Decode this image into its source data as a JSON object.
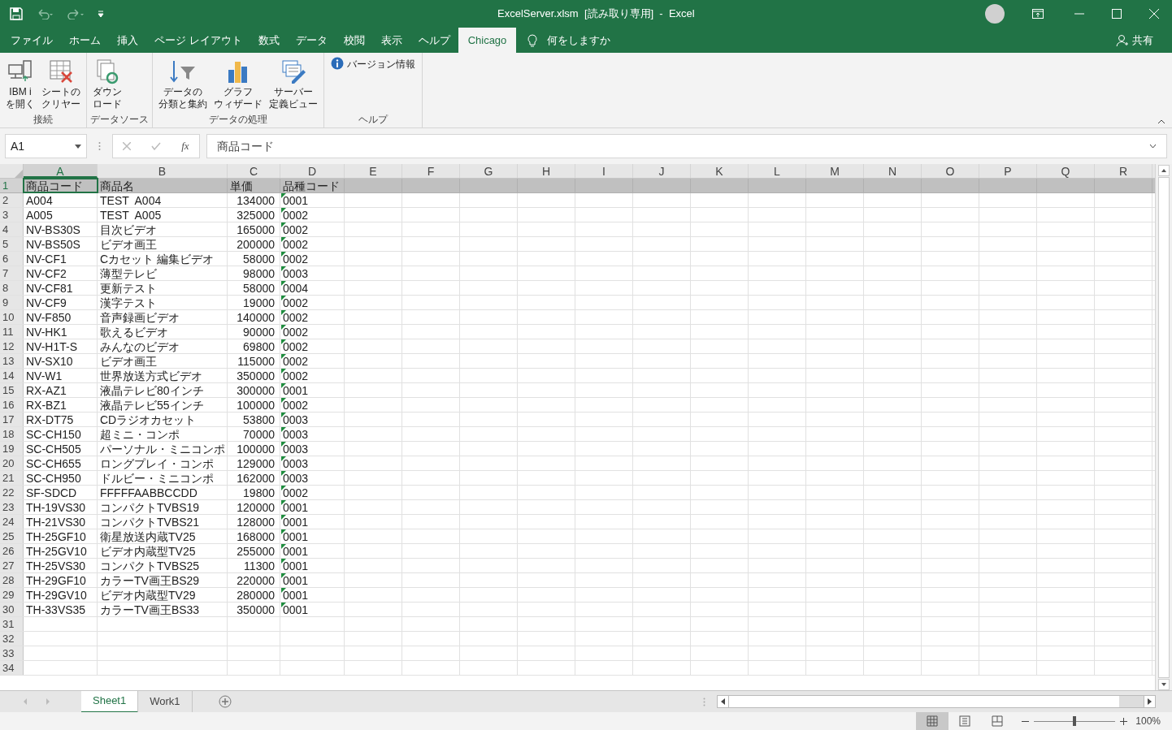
{
  "window": {
    "title": "ExcelServer.xlsm  [読み取り専用]  -  Excel"
  },
  "menu_tabs": [
    {
      "label": "ファイル",
      "selected": false
    },
    {
      "label": "ホーム",
      "selected": false
    },
    {
      "label": "挿入",
      "selected": false
    },
    {
      "label": "ページ レイアウト",
      "selected": false
    },
    {
      "label": "数式",
      "selected": false
    },
    {
      "label": "データ",
      "selected": false
    },
    {
      "label": "校閲",
      "selected": false
    },
    {
      "label": "表示",
      "selected": false
    },
    {
      "label": "ヘルプ",
      "selected": false
    },
    {
      "label": "Chicago",
      "selected": true
    }
  ],
  "tell_me": "何をしますか",
  "share": "共有",
  "ribbon_groups": [
    {
      "label": "接続",
      "buttons": [
        {
          "kind": "computer",
          "lines": [
            "IBM i",
            "を開く"
          ]
        },
        {
          "kind": "clear",
          "lines": [
            "シートの",
            "クリヤー"
          ]
        }
      ]
    },
    {
      "label": "データソース",
      "buttons": [
        {
          "kind": "download",
          "lines": [
            "ダウン",
            "ロード"
          ]
        }
      ]
    },
    {
      "label": "データの処理",
      "buttons": [
        {
          "kind": "sort",
          "lines": [
            "データの",
            "分類と集約"
          ]
        },
        {
          "kind": "chart",
          "lines": [
            "グラフ",
            "ウィザード"
          ]
        },
        {
          "kind": "view",
          "lines": [
            "サーバー",
            "定義ビュー"
          ]
        }
      ]
    },
    {
      "label": "ヘルプ",
      "buttons": [
        {
          "kind": "info",
          "lines": [
            "バージョン情報"
          ]
        }
      ]
    }
  ],
  "name_box": "A1",
  "function_button": "fx",
  "formula": "商品コード",
  "columns": [
    {
      "label": "A",
      "selected": true
    },
    {
      "label": "B",
      "selected": false
    },
    {
      "label": "C",
      "selected": false
    },
    {
      "label": "D",
      "selected": false
    },
    {
      "label": "E",
      "selected": false
    },
    {
      "label": "F",
      "selected": false
    },
    {
      "label": "G",
      "selected": false
    },
    {
      "label": "H",
      "selected": false
    },
    {
      "label": "I",
      "selected": false
    },
    {
      "label": "J",
      "selected": false
    },
    {
      "label": "K",
      "selected": false
    },
    {
      "label": "L",
      "selected": false
    },
    {
      "label": "M",
      "selected": false
    },
    {
      "label": "N",
      "selected": false
    },
    {
      "label": "O",
      "selected": false
    },
    {
      "label": "P",
      "selected": false
    },
    {
      "label": "Q",
      "selected": false
    },
    {
      "label": "R",
      "selected": false
    }
  ],
  "rows": [
    {
      "number": "1",
      "kind": "header",
      "selected": true,
      "flagged": false,
      "cells": [
        "商品コード",
        "商品名",
        "単価",
        "品種コード"
      ]
    },
    {
      "number": "2",
      "kind": "data",
      "selected": false,
      "flagged": true,
      "cells": [
        "A004",
        "TEST  A004",
        "134000",
        "0001"
      ]
    },
    {
      "number": "3",
      "kind": "data",
      "selected": false,
      "flagged": true,
      "cells": [
        "A005",
        "TEST  A005",
        "325000",
        "0002"
      ]
    },
    {
      "number": "4",
      "kind": "data",
      "selected": false,
      "flagged": true,
      "cells": [
        "NV-BS30S",
        "目次ビデオ",
        "165000",
        "0002"
      ]
    },
    {
      "number": "5",
      "kind": "data",
      "selected": false,
      "flagged": true,
      "cells": [
        "NV-BS50S",
        "ビデオ画王",
        "200000",
        "0002"
      ]
    },
    {
      "number": "6",
      "kind": "data",
      "selected": false,
      "flagged": true,
      "cells": [
        "NV-CF1",
        "Cカセット 編集ビデオ",
        "58000",
        "0002"
      ]
    },
    {
      "number": "7",
      "kind": "data",
      "selected": false,
      "flagged": true,
      "cells": [
        "NV-CF2",
        "薄型テレビ",
        "98000",
        "0003"
      ]
    },
    {
      "number": "8",
      "kind": "data",
      "selected": false,
      "flagged": true,
      "cells": [
        "NV-CF81",
        "更新テスト",
        "58000",
        "0004"
      ]
    },
    {
      "number": "9",
      "kind": "data",
      "selected": false,
      "flagged": true,
      "cells": [
        "NV-CF9",
        "漢字テスト",
        "19000",
        "0002"
      ]
    },
    {
      "number": "10",
      "kind": "data",
      "selected": false,
      "flagged": true,
      "cells": [
        "NV-F850",
        "音声録画ビデオ",
        "140000",
        "0002"
      ]
    },
    {
      "number": "11",
      "kind": "data",
      "selected": false,
      "flagged": true,
      "cells": [
        "NV-HK1",
        "歌えるビデオ",
        "90000",
        "0002"
      ]
    },
    {
      "number": "12",
      "kind": "data",
      "selected": false,
      "flagged": true,
      "cells": [
        "NV-H1T-S",
        "みんなのビデオ",
        "69800",
        "0002"
      ]
    },
    {
      "number": "13",
      "kind": "data",
      "selected": false,
      "flagged": true,
      "cells": [
        "NV-SX10",
        "ビデオ画王",
        "115000",
        "0002"
      ]
    },
    {
      "number": "14",
      "kind": "data",
      "selected": false,
      "flagged": true,
      "cells": [
        "NV-W1",
        "世界放送方式ビデオ",
        "350000",
        "0002"
      ]
    },
    {
      "number": "15",
      "kind": "data",
      "selected": false,
      "flagged": true,
      "cells": [
        "RX-AZ1",
        "液晶テレビ80インチ",
        "300000",
        "0001"
      ]
    },
    {
      "number": "16",
      "kind": "data",
      "selected": false,
      "flagged": true,
      "cells": [
        "RX-BZ1",
        "液晶テレビ55インチ",
        "100000",
        "0002"
      ]
    },
    {
      "number": "17",
      "kind": "data",
      "selected": false,
      "flagged": true,
      "cells": [
        "RX-DT75",
        "CDラジオカセット",
        "53800",
        "0003"
      ]
    },
    {
      "number": "18",
      "kind": "data",
      "selected": false,
      "flagged": true,
      "cells": [
        "SC-CH150",
        "超ミニ・コンポ",
        "70000",
        "0003"
      ]
    },
    {
      "number": "19",
      "kind": "data",
      "selected": false,
      "flagged": true,
      "cells": [
        "SC-CH505",
        "パーソナル・ミニコンポ",
        "100000",
        "0003"
      ]
    },
    {
      "number": "20",
      "kind": "data",
      "selected": false,
      "flagged": true,
      "cells": [
        "SC-CH655",
        "ロングプレイ・コンポ",
        "129000",
        "0003"
      ]
    },
    {
      "number": "21",
      "kind": "data",
      "selected": false,
      "flagged": true,
      "cells": [
        "SC-CH950",
        "ドルビー・ミニコンポ",
        "162000",
        "0003"
      ]
    },
    {
      "number": "22",
      "kind": "data",
      "selected": false,
      "flagged": true,
      "cells": [
        "SF-SDCD",
        "FFFFFAABBCCDD",
        "19800",
        "0002"
      ]
    },
    {
      "number": "23",
      "kind": "data",
      "selected": false,
      "flagged": true,
      "cells": [
        "TH-19VS30",
        "コンパクトTVBS19",
        "120000",
        "0001"
      ]
    },
    {
      "number": "24",
      "kind": "data",
      "selected": false,
      "flagged": true,
      "cells": [
        "TH-21VS30",
        "コンパクトTVBS21",
        "128000",
        "0001"
      ]
    },
    {
      "number": "25",
      "kind": "data",
      "selected": false,
      "flagged": true,
      "cells": [
        "TH-25GF10",
        "衛星放送内蔵TV25",
        "168000",
        "0001"
      ]
    },
    {
      "number": "26",
      "kind": "data",
      "selected": false,
      "flagged": true,
      "cells": [
        "TH-25GV10",
        "ビデオ内蔵型TV25",
        "255000",
        "0001"
      ]
    },
    {
      "number": "27",
      "kind": "data",
      "selected": false,
      "flagged": true,
      "cells": [
        "TH-25VS30",
        "コンパクトTVBS25",
        "11300",
        "0001"
      ]
    },
    {
      "number": "28",
      "kind": "data",
      "selected": false,
      "flagged": true,
      "cells": [
        "TH-29GF10",
        "カラーTV画王BS29",
        "220000",
        "0001"
      ]
    },
    {
      "number": "29",
      "kind": "data",
      "selected": false,
      "flagged": true,
      "cells": [
        "TH-29GV10",
        "ビデオ内蔵型TV29",
        "280000",
        "0001"
      ]
    },
    {
      "number": "30",
      "kind": "data",
      "selected": false,
      "flagged": true,
      "cells": [
        "TH-33VS35",
        "カラーTV画王BS33",
        "350000",
        "0001"
      ]
    },
    {
      "number": "31",
      "kind": "data",
      "selected": false,
      "flagged": false,
      "cells": []
    },
    {
      "number": "32",
      "kind": "data",
      "selected": false,
      "flagged": false,
      "cells": []
    },
    {
      "number": "33",
      "kind": "data",
      "selected": false,
      "flagged": false,
      "cells": []
    },
    {
      "number": "34",
      "kind": "data",
      "selected": false,
      "flagged": false,
      "cells": []
    }
  ],
  "sheet_tabs": [
    {
      "label": "Sheet1",
      "selected": true
    },
    {
      "label": "Work1",
      "selected": false
    }
  ],
  "status_bar": {
    "views": [
      {
        "kind": "normal",
        "selected": true
      },
      {
        "kind": "layout",
        "selected": false
      },
      {
        "kind": "pagebreak",
        "selected": false
      }
    ],
    "zoom": {
      "level": 0.5,
      "reading": "100%"
    }
  }
}
